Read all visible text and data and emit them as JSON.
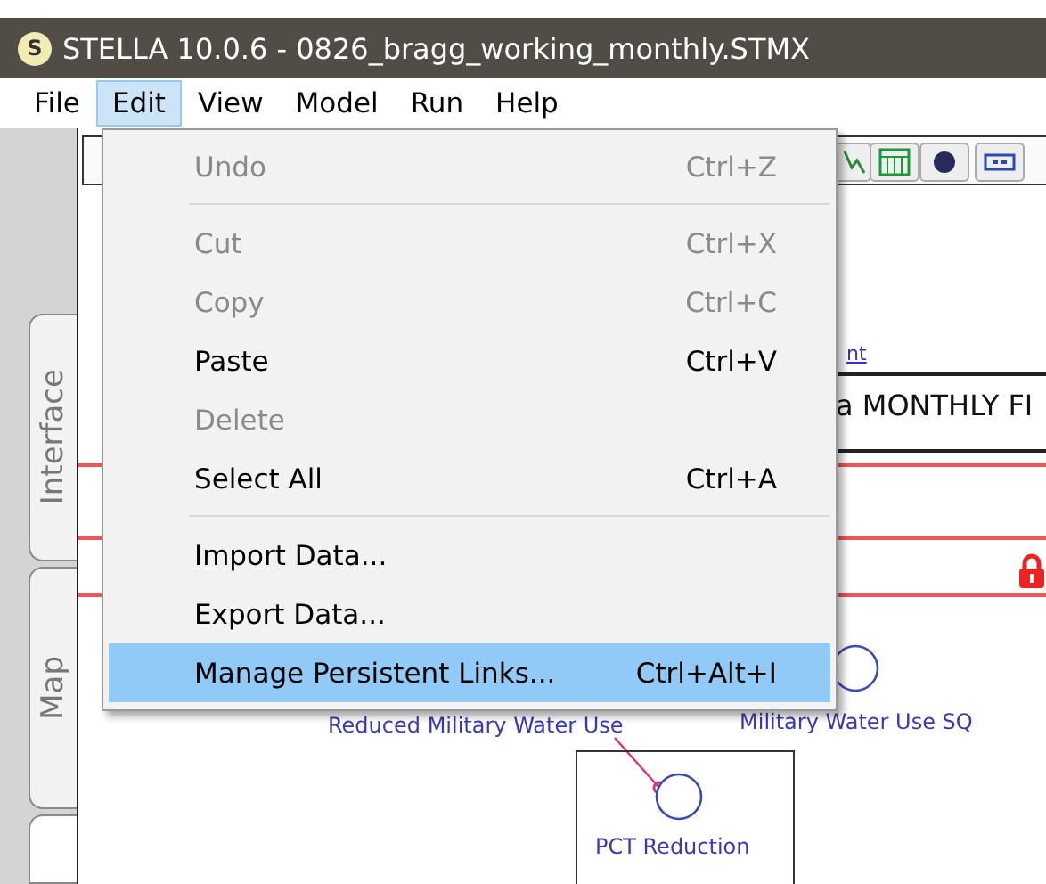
{
  "window": {
    "title": "STELLA 10.0.6 - 0826_bragg_working_monthly.STMX",
    "app_icon_letter": "S"
  },
  "menubar": [
    {
      "label": "File",
      "selected": false
    },
    {
      "label": "Edit",
      "selected": true
    },
    {
      "label": "View",
      "selected": false
    },
    {
      "label": "Model",
      "selected": false
    },
    {
      "label": "Run",
      "selected": false
    },
    {
      "label": "Help",
      "selected": false
    }
  ],
  "side_tabs": [
    {
      "label": "Interface",
      "selected": false
    },
    {
      "label": "Map",
      "selected": false
    }
  ],
  "edit_menu": [
    {
      "kind": "item",
      "label": "Undo",
      "shortcut": "Ctrl+Z",
      "disabled": true,
      "selected": false
    },
    {
      "kind": "separator"
    },
    {
      "kind": "item",
      "label": "Cut",
      "shortcut": "Ctrl+X",
      "disabled": true,
      "selected": false
    },
    {
      "kind": "item",
      "label": "Copy",
      "shortcut": "Ctrl+C",
      "disabled": true,
      "selected": false
    },
    {
      "kind": "item",
      "label": "Paste",
      "shortcut": "Ctrl+V",
      "disabled": false,
      "selected": false
    },
    {
      "kind": "item",
      "label": "Delete",
      "disabled": true,
      "selected": false
    },
    {
      "kind": "item",
      "label": "Select All",
      "shortcut": "Ctrl+A",
      "disabled": false,
      "selected": false
    },
    {
      "kind": "separator"
    },
    {
      "kind": "item",
      "label": "Import Data...",
      "disabled": false,
      "selected": false
    },
    {
      "kind": "item",
      "label": "Export Data...",
      "disabled": false,
      "selected": false
    },
    {
      "kind": "item",
      "label": "Manage Persistent Links...",
      "shortcut": "Ctrl+Alt+I",
      "disabled": false,
      "selected": true
    }
  ],
  "canvas": {
    "fragment_label": "nt",
    "banner_text": "a MONTHLY FI",
    "converters": [
      {
        "label": "Reduced Military Water Use"
      },
      {
        "label": "Military Water Use SQ"
      },
      {
        "label": "PCT Reduction"
      }
    ]
  }
}
